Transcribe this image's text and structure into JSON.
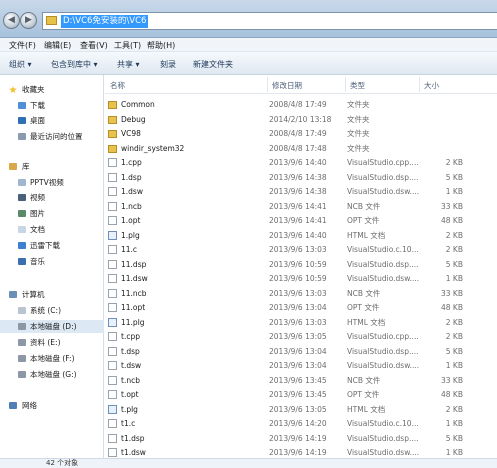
{
  "address": {
    "path": "D:\\VC6免安装的\\VC6"
  },
  "menu": [
    "文件(F)",
    "编辑(E)",
    "查看(V)",
    "工具(T)",
    "帮助(H)"
  ],
  "toolbar": {
    "organize": "组织 ▾",
    "include": "包含到库中 ▾",
    "share": "共享 ▾",
    "burn": "刻录",
    "new_folder": "新建文件夹"
  },
  "nav": {
    "favorites": "收藏夹",
    "downloads": "下载",
    "desktop": "桌面",
    "recent": "最近访问的位置",
    "libraries": "库",
    "pptv": "PPTV视频",
    "videos": "视频",
    "pictures": "图片",
    "documents": "文档",
    "xunlei": "迅雷下载",
    "music": "音乐",
    "computer": "计算机",
    "drive_c": "系统 (C:)",
    "drive_d": "本地磁盘 (D:)",
    "drive_e": "资料 (E:)",
    "drive_f": "本地磁盘 (F:)",
    "drive_g": "本地磁盘 (G:)",
    "network": "网络"
  },
  "columns": {
    "name": "名称",
    "date": "修改日期",
    "type": "类型",
    "size": "大小"
  },
  "files": [
    {
      "name": "Common",
      "date": "2008/4/8 17:49",
      "type": "文件夹",
      "size": "",
      "kind": "folder"
    },
    {
      "name": "Debug",
      "date": "2014/2/10 13:18",
      "type": "文件夹",
      "size": "",
      "kind": "folder"
    },
    {
      "name": "VC98",
      "date": "2008/4/8 17:49",
      "type": "文件夹",
      "size": "",
      "kind": "folder"
    },
    {
      "name": "windir_system32",
      "date": "2008/4/8 17:48",
      "type": "文件夹",
      "size": "",
      "kind": "folder"
    },
    {
      "name": "1.cpp",
      "date": "2013/9/6 14:40",
      "type": "VisualStudio.cpp....",
      "size": "2 KB",
      "kind": "file"
    },
    {
      "name": "1.dsp",
      "date": "2013/9/6 14:38",
      "type": "VisualStudio.dsp....",
      "size": "5 KB",
      "kind": "file"
    },
    {
      "name": "1.dsw",
      "date": "2013/9/6 14:38",
      "type": "VisualStudio.dsw....",
      "size": "1 KB",
      "kind": "file"
    },
    {
      "name": "1.ncb",
      "date": "2013/9/6 14:41",
      "type": "NCB 文件",
      "size": "33 KB",
      "kind": "file"
    },
    {
      "name": "1.opt",
      "date": "2013/9/6 14:41",
      "type": "OPT 文件",
      "size": "48 KB",
      "kind": "file"
    },
    {
      "name": "1.plg",
      "date": "2013/9/6 14:40",
      "type": "HTML 文档",
      "size": "2 KB",
      "kind": "plg"
    },
    {
      "name": "11.c",
      "date": "2013/9/6 13:03",
      "type": "VisualStudio.c.10...",
      "size": "2 KB",
      "kind": "file"
    },
    {
      "name": "11.dsp",
      "date": "2013/9/6 10:59",
      "type": "VisualStudio.dsp....",
      "size": "5 KB",
      "kind": "file"
    },
    {
      "name": "11.dsw",
      "date": "2013/9/6 10:59",
      "type": "VisualStudio.dsw....",
      "size": "1 KB",
      "kind": "file"
    },
    {
      "name": "11.ncb",
      "date": "2013/9/6 13:03",
      "type": "NCB 文件",
      "size": "33 KB",
      "kind": "file"
    },
    {
      "name": "11.opt",
      "date": "2013/9/6 13:04",
      "type": "OPT 文件",
      "size": "48 KB",
      "kind": "file"
    },
    {
      "name": "11.plg",
      "date": "2013/9/6 13:03",
      "type": "HTML 文档",
      "size": "2 KB",
      "kind": "plg"
    },
    {
      "name": "t.cpp",
      "date": "2013/9/6 13:05",
      "type": "VisualStudio.cpp....",
      "size": "2 KB",
      "kind": "file"
    },
    {
      "name": "t.dsp",
      "date": "2013/9/6 13:04",
      "type": "VisualStudio.dsp....",
      "size": "5 KB",
      "kind": "file"
    },
    {
      "name": "t.dsw",
      "date": "2013/9/6 13:04",
      "type": "VisualStudio.dsw....",
      "size": "1 KB",
      "kind": "file"
    },
    {
      "name": "t.ncb",
      "date": "2013/9/6 13:45",
      "type": "NCB 文件",
      "size": "33 KB",
      "kind": "file"
    },
    {
      "name": "t.opt",
      "date": "2013/9/6 13:45",
      "type": "OPT 文件",
      "size": "48 KB",
      "kind": "file"
    },
    {
      "name": "t.plg",
      "date": "2013/9/6 13:05",
      "type": "HTML 文档",
      "size": "2 KB",
      "kind": "plg"
    },
    {
      "name": "t1.c",
      "date": "2013/9/6 14:20",
      "type": "VisualStudio.c.10...",
      "size": "1 KB",
      "kind": "file"
    },
    {
      "name": "t1.dsp",
      "date": "2013/9/6 14:19",
      "type": "VisualStudio.dsp....",
      "size": "5 KB",
      "kind": "file"
    },
    {
      "name": "t1.dsw",
      "date": "2013/9/6 14:19",
      "type": "VisualStudio.dsw....",
      "size": "1 KB",
      "kind": "file"
    }
  ],
  "status": {
    "count": "42 个对象"
  }
}
